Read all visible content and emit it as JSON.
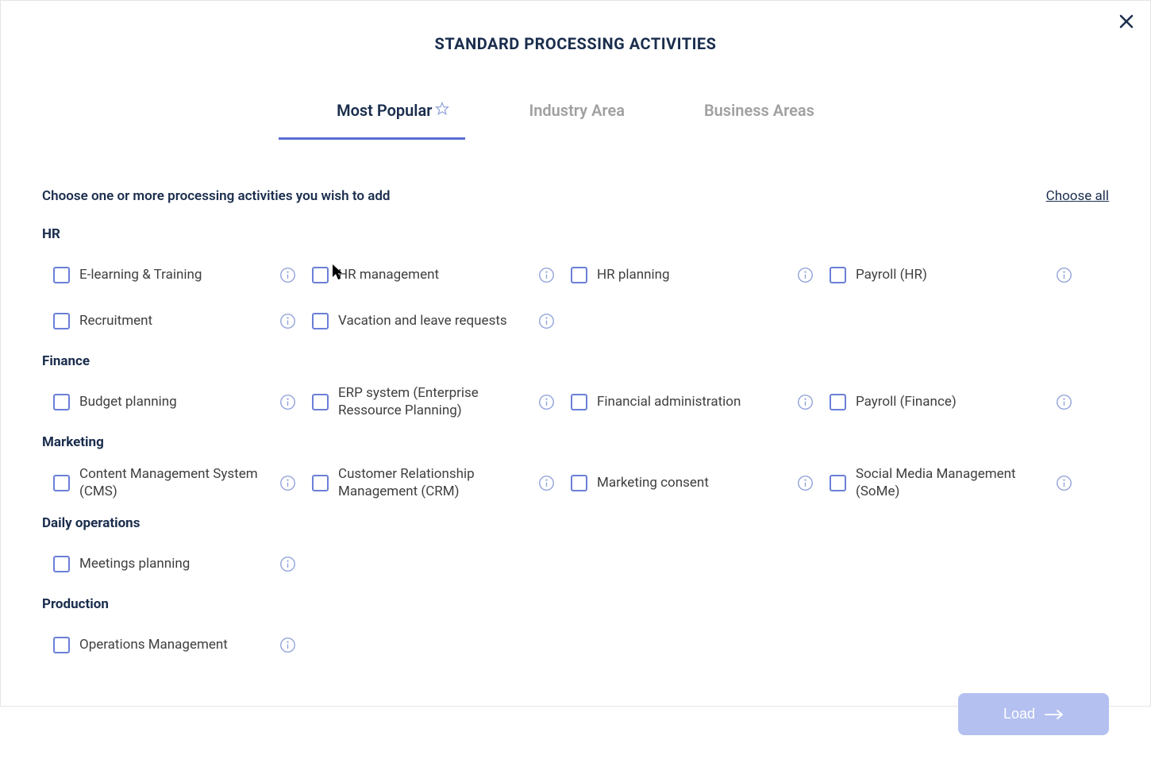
{
  "title": "STANDARD PROCESSING ACTIVITIES",
  "tabs": [
    {
      "label": "Most Popular",
      "active": true,
      "hasIcon": true
    },
    {
      "label": "Industry Area",
      "active": false,
      "hasIcon": false
    },
    {
      "label": "Business Areas",
      "active": false,
      "hasIcon": false
    }
  ],
  "instruction": "Choose one or more processing activities you wish to add",
  "chooseAll": "Choose all",
  "loadButton": "Load",
  "categories": [
    {
      "name": "HR",
      "items": [
        {
          "label": "E-learning & Training"
        },
        {
          "label": "HR management"
        },
        {
          "label": "HR planning"
        },
        {
          "label": "Payroll (HR)"
        },
        {
          "label": "Recruitment"
        },
        {
          "label": "Vacation and leave requests"
        }
      ]
    },
    {
      "name": "Finance",
      "items": [
        {
          "label": "Budget planning"
        },
        {
          "label": "ERP system (Enterprise Ressource Planning)"
        },
        {
          "label": "Financial administration"
        },
        {
          "label": "Payroll (Finance)"
        }
      ]
    },
    {
      "name": "Marketing",
      "items": [
        {
          "label": "Content Management System (CMS)"
        },
        {
          "label": "Customer Relationship Management (CRM)"
        },
        {
          "label": "Marketing consent"
        },
        {
          "label": "Social Media Management (SoMe)"
        }
      ]
    },
    {
      "name": "Daily operations",
      "items": [
        {
          "label": "Meetings planning"
        }
      ]
    },
    {
      "name": "Production",
      "items": [
        {
          "label": "Operations Management"
        }
      ]
    }
  ]
}
